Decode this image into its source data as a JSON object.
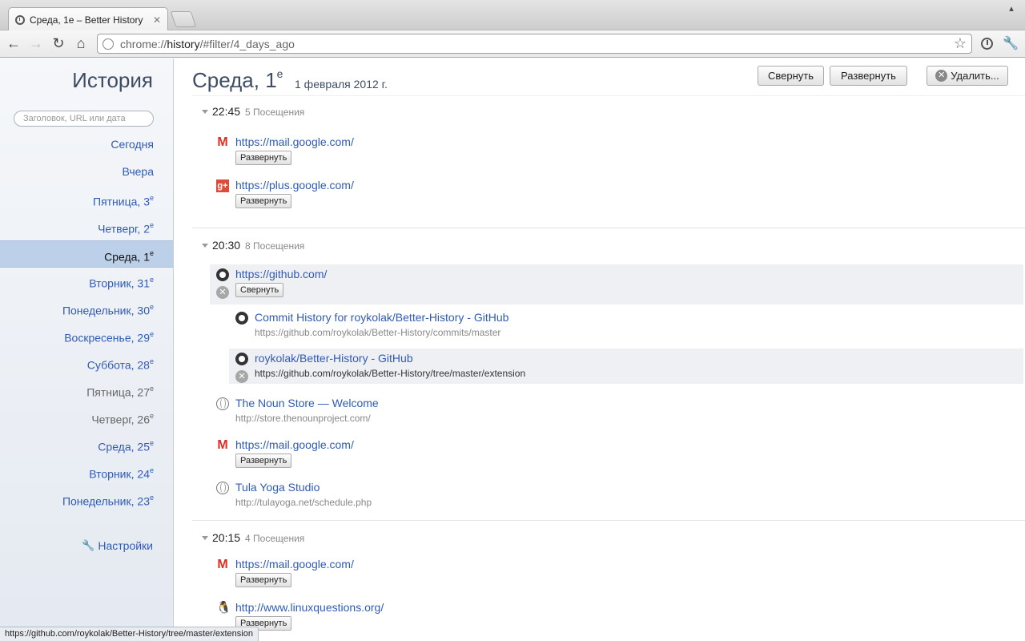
{
  "browser": {
    "tab_title": "Среда, 1е – Better History",
    "tab_close": "✕",
    "url_prefix": "chrome://",
    "url_host": "history",
    "url_rest": "/#filter/4_days_ago"
  },
  "sidebar": {
    "title": "История",
    "search_placeholder": "Заголовок, URL или дата",
    "items": [
      {
        "label": "Сегодня",
        "sup": ""
      },
      {
        "label": "Вчера",
        "sup": ""
      },
      {
        "label": "Пятница, 3",
        "sup": "е"
      },
      {
        "label": "Четверг, 2",
        "sup": "е"
      },
      {
        "label": "Среда, 1",
        "sup": "е"
      },
      {
        "label": "Вторник, 31",
        "sup": "е"
      },
      {
        "label": "Понедельник, 30",
        "sup": "е"
      },
      {
        "label": "Воскресенье, 29",
        "sup": "е"
      },
      {
        "label": "Суббота, 28",
        "sup": "е"
      },
      {
        "label": "Пятница, 27",
        "sup": "е"
      },
      {
        "label": "Четверг, 26",
        "sup": "е"
      },
      {
        "label": "Среда, 25",
        "sup": "е"
      },
      {
        "label": "Вторник, 24",
        "sup": "е"
      },
      {
        "label": "Понедельник, 23",
        "sup": "е"
      }
    ],
    "selected_index": 4,
    "settings_label": "Настройки"
  },
  "main": {
    "title": "Среда, 1",
    "title_sup": "е",
    "date": "1 февраля 2012 г.",
    "collapse_all": "Свернуть",
    "expand_all": "Развернуть",
    "delete": "Удалить...",
    "groups": [
      {
        "time": "22:45",
        "count": "5 Посещения",
        "visits": [
          {
            "icon": "gmail-icon",
            "link": "https://mail.google.com/",
            "button": "Развернуть"
          },
          {
            "icon": "google-plus-icon",
            "link": "https://plus.google.com/",
            "button": "Развернуть"
          }
        ]
      },
      {
        "time": "20:30",
        "count": "8 Посещения",
        "visits": [
          {
            "icon": "github-icon",
            "link": "https://github.com/",
            "button": "Свернуть"
          },
          {
            "icon": "github-icon",
            "link": "Commit History for roykolak/Better-History - GitHub",
            "url": "https://github.com/roykolak/Better-History/commits/master"
          },
          {
            "icon": "github-icon",
            "link": "roykolak/Better-History - GitHub",
            "url": "https://github.com/roykolak/Better-History/tree/master/extension"
          },
          {
            "icon": "globe-icon",
            "link": "The Noun Store — Welcome",
            "url": "http://store.thenounproject.com/"
          },
          {
            "icon": "gmail-icon",
            "link": "https://mail.google.com/",
            "button": "Развернуть"
          },
          {
            "icon": "globe-icon",
            "link": "Tula Yoga Studio",
            "url": "http://tulayoga.net/schedule.php"
          }
        ]
      },
      {
        "time": "20:15",
        "count": "4 Посещения",
        "visits": [
          {
            "icon": "gmail-icon",
            "link": "https://mail.google.com/",
            "button": "Развернуть"
          },
          {
            "icon": "linux-icon",
            "link": "http://www.linuxquestions.org/",
            "button": "Развернуть"
          }
        ]
      }
    ]
  },
  "status_url": "https://github.com/roykolak/Better-History/tree/master/extension"
}
